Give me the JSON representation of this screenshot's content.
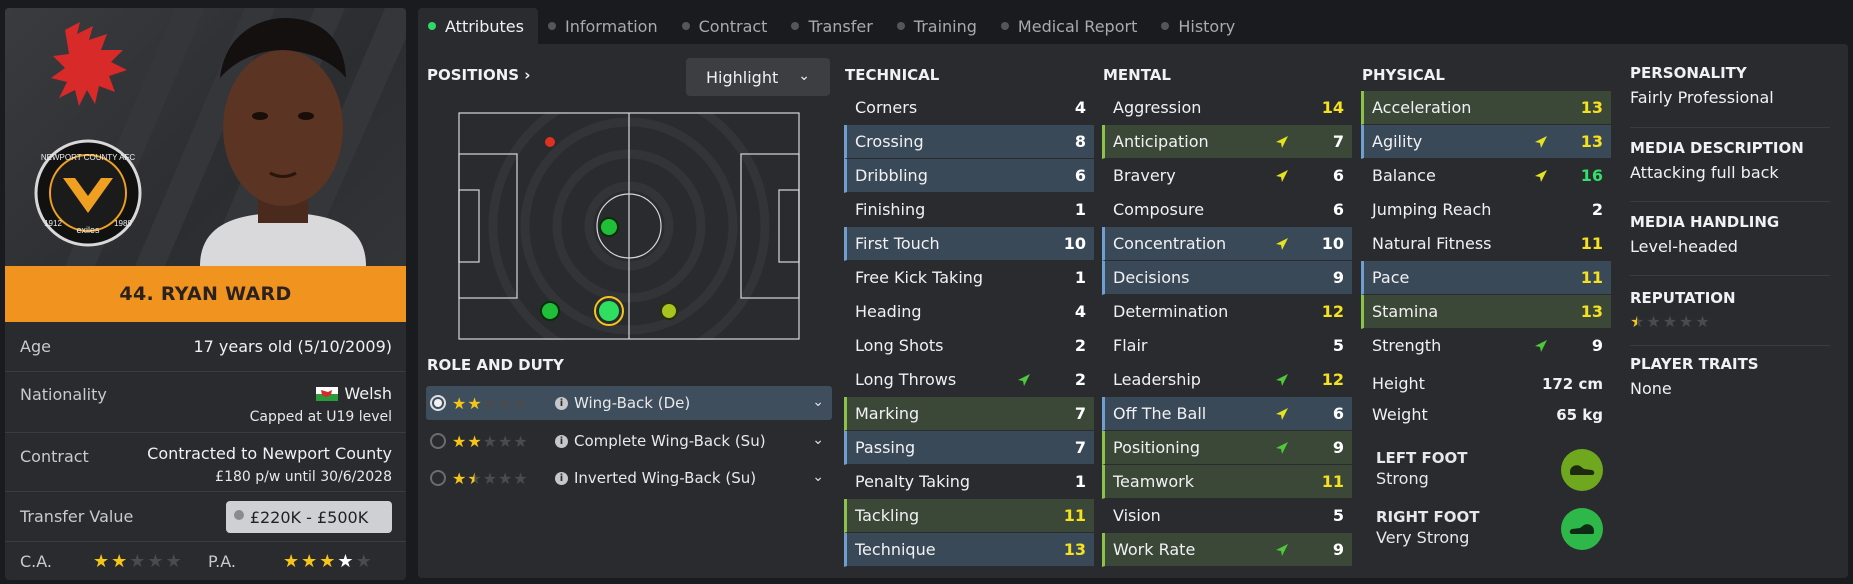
{
  "player": {
    "name": "44. RYAN WARD",
    "age_label": "Age",
    "age_value": "17 years old (5/10/2009)",
    "nationality_label": "Nationality",
    "nationality_value": "Welsh",
    "nationality_sub": "Capped at U19 level",
    "contract_label": "Contract",
    "contract_value": "Contracted to Newport County",
    "contract_sub": "£180 p/w until 30/6/2028",
    "transfer_label": "Transfer Value",
    "transfer_value": "£220K - £500K",
    "ca_label": "C.A.",
    "pa_label": "P.A.",
    "ca_stars": 2,
    "pa_stars": 3.5,
    "club_crest_text": "NEWPORT COUNTY AFC",
    "club_crest_sub": "exiles",
    "club_year_left": "1912",
    "club_year_right": "1989"
  },
  "tabs": [
    "Attributes",
    "Information",
    "Contract",
    "Transfer",
    "Training",
    "Medical Report",
    "History"
  ],
  "positions": {
    "heading": "POSITIONS",
    "highlight_label": "Highlight"
  },
  "roles": {
    "heading": "ROLE AND DUTY",
    "items": [
      {
        "label": "Wing-Back (De)",
        "stars": 2,
        "selected": true
      },
      {
        "label": "Complete Wing-Back (Su)",
        "stars": 2,
        "selected": false
      },
      {
        "label": "Inverted Wing-Back (Su)",
        "stars": 1.5,
        "selected": false
      }
    ]
  },
  "technical": {
    "heading": "TECHNICAL",
    "items": [
      {
        "name": "Corners",
        "value": "4",
        "hl": "",
        "color": "white",
        "arrow": ""
      },
      {
        "name": "Crossing",
        "value": "8",
        "hl": "blue",
        "color": "white",
        "arrow": ""
      },
      {
        "name": "Dribbling",
        "value": "6",
        "hl": "blue",
        "color": "white",
        "arrow": ""
      },
      {
        "name": "Finishing",
        "value": "1",
        "hl": "",
        "color": "white",
        "arrow": ""
      },
      {
        "name": "First Touch",
        "value": "10",
        "hl": "blue",
        "color": "white",
        "arrow": ""
      },
      {
        "name": "Free Kick Taking",
        "value": "1",
        "hl": "",
        "color": "white",
        "arrow": ""
      },
      {
        "name": "Heading",
        "value": "4",
        "hl": "",
        "color": "white",
        "arrow": ""
      },
      {
        "name": "Long Shots",
        "value": "2",
        "hl": "",
        "color": "white",
        "arrow": ""
      },
      {
        "name": "Long Throws",
        "value": "2",
        "hl": "",
        "color": "white",
        "arrow": "green"
      },
      {
        "name": "Marking",
        "value": "7",
        "hl": "green",
        "color": "white",
        "arrow": ""
      },
      {
        "name": "Passing",
        "value": "7",
        "hl": "blue",
        "color": "white",
        "arrow": ""
      },
      {
        "name": "Penalty Taking",
        "value": "1",
        "hl": "",
        "color": "white",
        "arrow": ""
      },
      {
        "name": "Tackling",
        "value": "11",
        "hl": "green",
        "color": "yellow",
        "arrow": ""
      },
      {
        "name": "Technique",
        "value": "13",
        "hl": "blue",
        "color": "yellow",
        "arrow": ""
      }
    ]
  },
  "mental": {
    "heading": "MENTAL",
    "items": [
      {
        "name": "Aggression",
        "value": "14",
        "hl": "",
        "color": "yellow",
        "arrow": ""
      },
      {
        "name": "Anticipation",
        "value": "7",
        "hl": "green",
        "color": "white",
        "arrow": "yellow"
      },
      {
        "name": "Bravery",
        "value": "6",
        "hl": "",
        "color": "white",
        "arrow": "yellow"
      },
      {
        "name": "Composure",
        "value": "6",
        "hl": "",
        "color": "white",
        "arrow": ""
      },
      {
        "name": "Concentration",
        "value": "10",
        "hl": "blue",
        "color": "white",
        "arrow": "yellow"
      },
      {
        "name": "Decisions",
        "value": "9",
        "hl": "blue",
        "color": "white",
        "arrow": ""
      },
      {
        "name": "Determination",
        "value": "12",
        "hl": "",
        "color": "yellow",
        "arrow": ""
      },
      {
        "name": "Flair",
        "value": "5",
        "hl": "",
        "color": "white",
        "arrow": ""
      },
      {
        "name": "Leadership",
        "value": "12",
        "hl": "",
        "color": "yellow",
        "arrow": "green"
      },
      {
        "name": "Off The Ball",
        "value": "6",
        "hl": "blue",
        "color": "white",
        "arrow": "yellow"
      },
      {
        "name": "Positioning",
        "value": "9",
        "hl": "green",
        "color": "white",
        "arrow": "green"
      },
      {
        "name": "Teamwork",
        "value": "11",
        "hl": "green",
        "color": "yellow",
        "arrow": ""
      },
      {
        "name": "Vision",
        "value": "5",
        "hl": "",
        "color": "white",
        "arrow": ""
      },
      {
        "name": "Work Rate",
        "value": "9",
        "hl": "green",
        "color": "white",
        "arrow": "green"
      }
    ]
  },
  "physical": {
    "heading": "PHYSICAL",
    "items": [
      {
        "name": "Acceleration",
        "value": "13",
        "hl": "green",
        "color": "yellow",
        "arrow": ""
      },
      {
        "name": "Agility",
        "value": "13",
        "hl": "blue",
        "color": "yellow",
        "arrow": "yellow"
      },
      {
        "name": "Balance",
        "value": "16",
        "hl": "",
        "color": "green",
        "arrow": "yellow"
      },
      {
        "name": "Jumping Reach",
        "value": "2",
        "hl": "",
        "color": "white",
        "arrow": ""
      },
      {
        "name": "Natural Fitness",
        "value": "11",
        "hl": "",
        "color": "yellow",
        "arrow": ""
      },
      {
        "name": "Pace",
        "value": "11",
        "hl": "blue",
        "color": "yellow",
        "arrow": ""
      },
      {
        "name": "Stamina",
        "value": "13",
        "hl": "green",
        "color": "yellow",
        "arrow": ""
      },
      {
        "name": "Strength",
        "value": "9",
        "hl": "",
        "color": "white",
        "arrow": "green"
      }
    ],
    "height_label": "Height",
    "height_value": "172 cm",
    "weight_label": "Weight",
    "weight_value": "65 kg"
  },
  "feet": {
    "left_label": "LEFT FOOT",
    "left_value": "Strong",
    "right_label": "RIGHT FOOT",
    "right_value": "Very Strong",
    "left_color": "#6fa81f",
    "right_color": "#2fb84a"
  },
  "side": {
    "personality_h": "PERSONALITY",
    "personality_v": "Fairly Professional",
    "media_desc_h": "MEDIA DESCRIPTION",
    "media_desc_v": "Attacking full back",
    "media_handling_h": "MEDIA HANDLING",
    "media_handling_v": "Level-headed",
    "reputation_h": "REPUTATION",
    "reputation_stars": 0.5,
    "traits_h": "PLAYER TRAITS",
    "traits_v": "None"
  },
  "colors": {
    "accent": "#f0941f",
    "highlight_blue": "#3a4957",
    "highlight_green": "#3b4838",
    "value_yellow": "#f5e11f",
    "value_green": "#33e06a"
  }
}
